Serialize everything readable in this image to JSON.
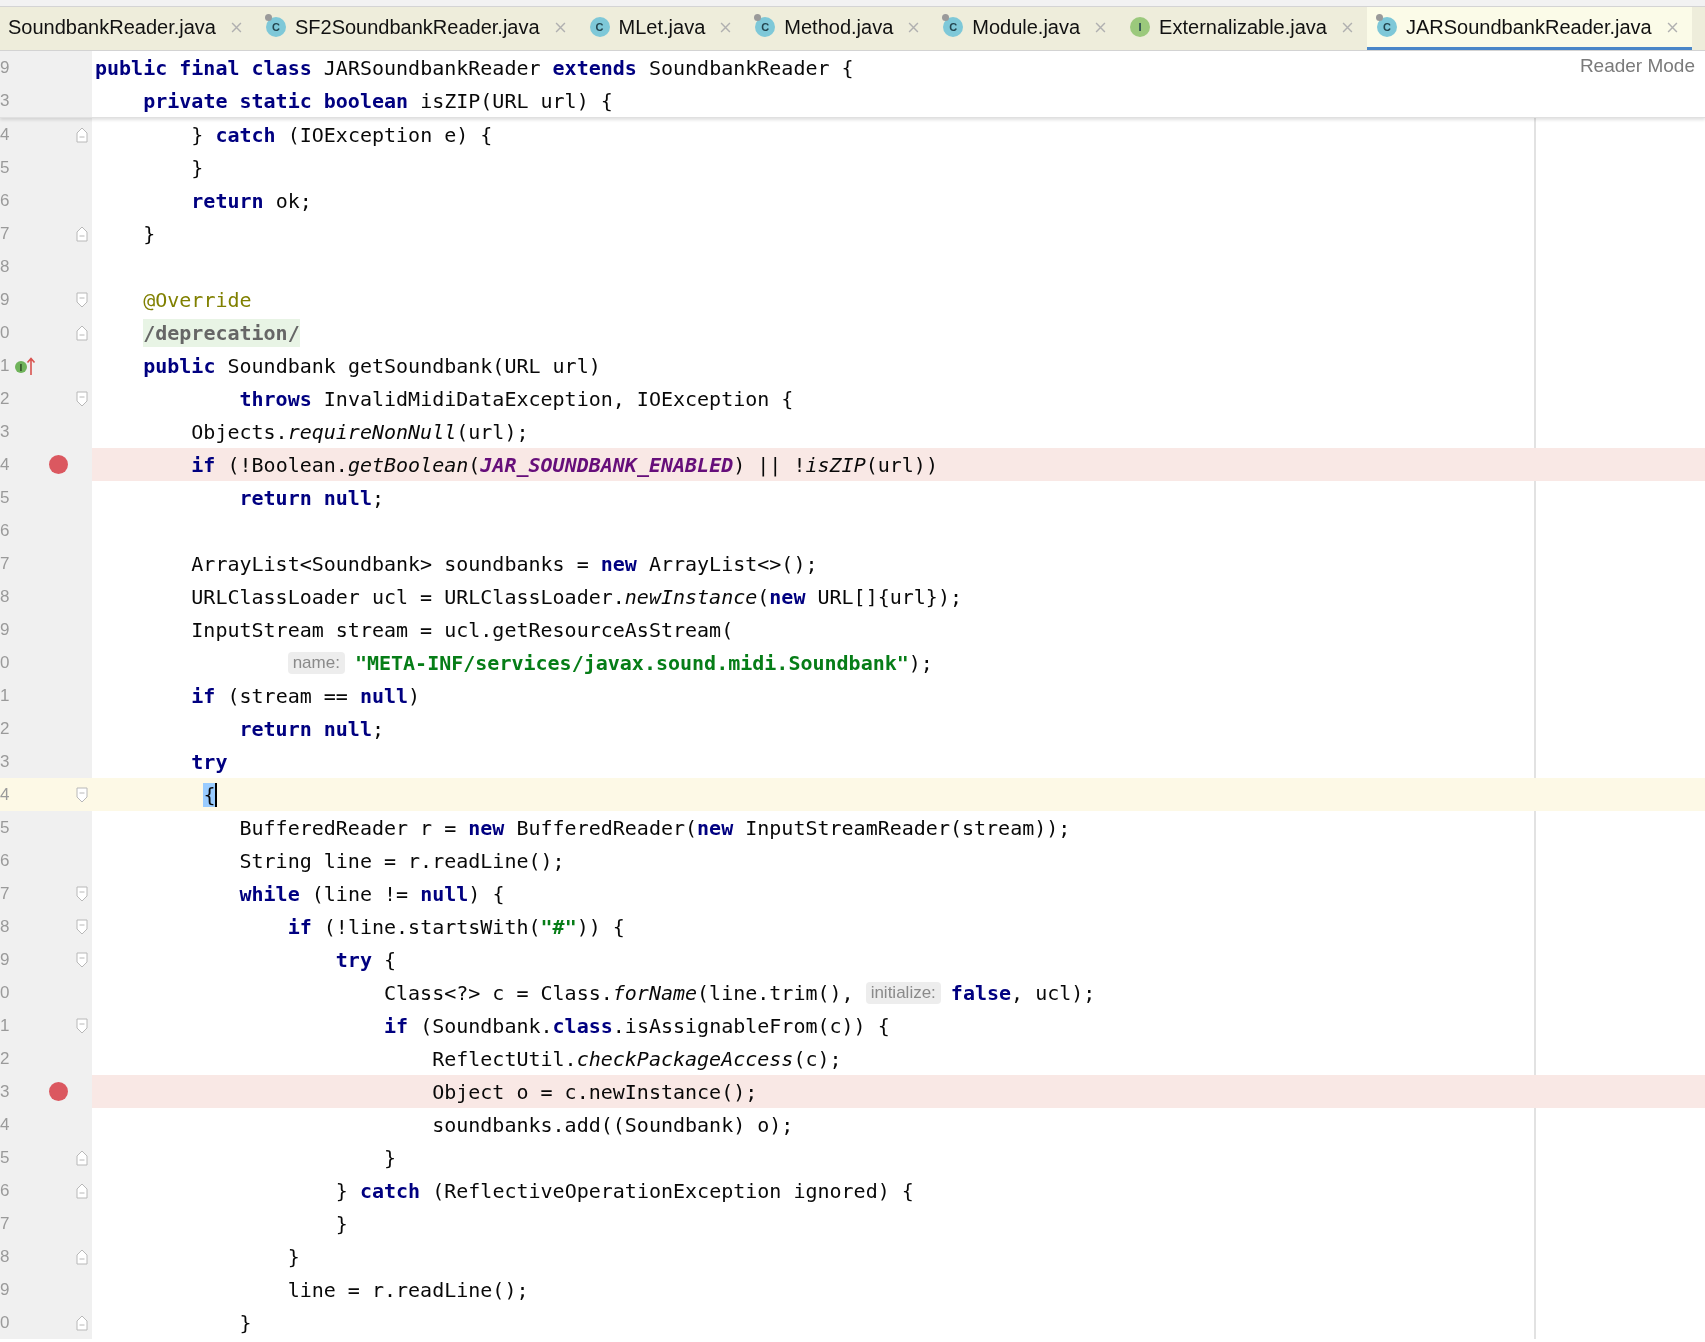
{
  "tabs": [
    {
      "label": "SoundbankReader.java",
      "selected": false
    },
    {
      "label": "SF2SoundbankReader.java",
      "selected": false,
      "icon": {
        "letter": "C",
        "color": "#7ec8d8",
        "locked": true
      }
    },
    {
      "label": "MLet.java",
      "selected": false,
      "icon": {
        "letter": "C",
        "color": "#7ec8d8",
        "locked": false
      }
    },
    {
      "label": "Method.java",
      "selected": false,
      "icon": {
        "letter": "C",
        "color": "#7ec8d8",
        "locked": true
      }
    },
    {
      "label": "Module.java",
      "selected": false,
      "icon": {
        "letter": "C",
        "color": "#7ec8d8",
        "locked": true
      }
    },
    {
      "label": "Externalizable.java",
      "selected": false,
      "icon": {
        "letter": "I",
        "color": "#9bc97c",
        "locked": false
      }
    },
    {
      "label": "JARSoundbankReader.java",
      "selected": true,
      "icon": {
        "letter": "C",
        "color": "#7ec8d8",
        "locked": true
      }
    }
  ],
  "reader_mode": "Reader Mode",
  "sticky_lines": [
    {
      "number": "9",
      "tokens": [
        {
          "t": "public final class",
          "kind": "kw"
        },
        {
          "t": " JARSoundbankReader ",
          "kind": "plain"
        },
        {
          "t": "extends",
          "kind": "kw"
        },
        {
          "t": " SoundbankReader {",
          "kind": "plain"
        }
      ]
    },
    {
      "number": "3",
      "tokens": [
        {
          "t": "    private static boolean",
          "kind": "kw"
        },
        {
          "t": " isZIP(URL url) {",
          "kind": "plain"
        }
      ]
    }
  ],
  "lines": [
    {
      "number": "4",
      "breakpoint": false,
      "current": false,
      "fold": {
        "kind": "end"
      },
      "tokens": [
        {
          "t": "        } ",
          "kind": "plain"
        },
        {
          "t": "catch",
          "kind": "kw"
        },
        {
          "t": " (IOException e) {",
          "kind": "plain"
        }
      ]
    },
    {
      "number": "5",
      "breakpoint": false,
      "current": false,
      "tokens": [
        {
          "t": "        }",
          "kind": "plain"
        }
      ]
    },
    {
      "number": "6",
      "breakpoint": false,
      "current": false,
      "tokens": [
        {
          "t": "        return",
          "kind": "kw"
        },
        {
          "t": " ok;",
          "kind": "plain"
        }
      ]
    },
    {
      "number": "7",
      "breakpoint": false,
      "current": false,
      "fold": {
        "kind": "end"
      },
      "tokens": [
        {
          "t": "    }",
          "kind": "plain"
        }
      ]
    },
    {
      "number": "8",
      "breakpoint": false,
      "current": false
    },
    {
      "number": "9",
      "breakpoint": false,
      "current": false,
      "fold": {
        "kind": "start"
      },
      "tokens": [
        {
          "t": "    @Override",
          "kind": "annotation"
        }
      ]
    },
    {
      "number": "0",
      "breakpoint": false,
      "current": false,
      "fold": {
        "kind": "end"
      },
      "tokens": [
        {
          "t": "    /deprecation/",
          "kind": "folded"
        }
      ]
    },
    {
      "number": "1",
      "breakpoint": false,
      "current": false,
      "marker": {
        "letter": "I",
        "color": "#6fb35a"
      },
      "tokens": [
        {
          "t": "    public",
          "kind": "kw"
        },
        {
          "t": " Soundbank getSoundbank(URL url)",
          "kind": "plain"
        }
      ]
    },
    {
      "number": "2",
      "breakpoint": false,
      "current": false,
      "fold": {
        "kind": "start"
      },
      "tokens": [
        {
          "t": "            throws",
          "kind": "kw"
        },
        {
          "t": " InvalidMidiDataException, IOException {",
          "kind": "plain"
        }
      ]
    },
    {
      "number": "3",
      "breakpoint": false,
      "current": false,
      "tokens": [
        {
          "t": "        Objects.",
          "kind": "plain"
        },
        {
          "t": "requireNonNull",
          "kind": "method"
        },
        {
          "t": "(url);",
          "kind": "plain"
        }
      ]
    },
    {
      "number": "4",
      "breakpoint": true,
      "current": false,
      "tokens": [
        {
          "t": "        if",
          "kind": "kw"
        },
        {
          "t": " (!Boolean.",
          "kind": "plain"
        },
        {
          "t": "getBoolean",
          "kind": "method"
        },
        {
          "t": "(",
          "kind": "plain"
        },
        {
          "t": "JAR_SOUNDBANK_ENABLED",
          "kind": "constant"
        },
        {
          "t": ") || !",
          "kind": "plain"
        },
        {
          "t": "isZIP",
          "kind": "method"
        },
        {
          "t": "(url))",
          "kind": "plain"
        }
      ]
    },
    {
      "number": "5",
      "breakpoint": false,
      "current": false,
      "tokens": [
        {
          "t": "            return null",
          "kind": "kw"
        },
        {
          "t": ";",
          "kind": "plain"
        }
      ]
    },
    {
      "number": "6",
      "breakpoint": false,
      "current": false
    },
    {
      "number": "7",
      "breakpoint": false,
      "current": false,
      "tokens": [
        {
          "t": "        ArrayList<Soundbank> soundbanks = ",
          "kind": "plain"
        },
        {
          "t": "new",
          "kind": "kw"
        },
        {
          "t": " ArrayList<>();",
          "kind": "plain"
        }
      ]
    },
    {
      "number": "8",
      "breakpoint": false,
      "current": false,
      "tokens": [
        {
          "t": "        URLClassLoader ucl = URLClassLoader.",
          "kind": "plain"
        },
        {
          "t": "newInstance",
          "kind": "method"
        },
        {
          "t": "(",
          "kind": "plain"
        },
        {
          "t": "new",
          "kind": "kw"
        },
        {
          "t": " URL[]{url});",
          "kind": "plain"
        }
      ]
    },
    {
      "number": "9",
      "breakpoint": false,
      "current": false,
      "tokens": [
        {
          "t": "        InputStream stream = ucl.getResourceAsStream(",
          "kind": "plain"
        }
      ]
    },
    {
      "number": "0",
      "breakpoint": false,
      "current": false,
      "tokens": [
        {
          "t": "                name:",
          "kind": "hint"
        },
        {
          "t": "\"META-INF/services/javax.sound.midi.Soundbank\"",
          "kind": "string"
        },
        {
          "t": ");",
          "kind": "plain"
        }
      ]
    },
    {
      "number": "1",
      "breakpoint": false,
      "current": false,
      "tokens": [
        {
          "t": "        if",
          "kind": "kw"
        },
        {
          "t": " (stream == ",
          "kind": "plain"
        },
        {
          "t": "null",
          "kind": "kw"
        },
        {
          "t": ")",
          "kind": "plain"
        }
      ]
    },
    {
      "number": "2",
      "breakpoint": false,
      "current": false,
      "tokens": [
        {
          "t": "            return null",
          "kind": "kw"
        },
        {
          "t": ";",
          "kind": "plain"
        }
      ]
    },
    {
      "number": "3",
      "breakpoint": false,
      "current": false,
      "tokens": [
        {
          "t": "        try",
          "kind": "kw"
        }
      ]
    },
    {
      "number": "4",
      "breakpoint": false,
      "current": true,
      "fold": {
        "kind": "start"
      },
      "tokens": [
        {
          "t": "         {",
          "kind": "brace"
        }
      ]
    },
    {
      "number": "5",
      "breakpoint": false,
      "current": false,
      "tokens": [
        {
          "t": "            BufferedReader r = ",
          "kind": "plain"
        },
        {
          "t": "new",
          "kind": "kw"
        },
        {
          "t": " BufferedReader(",
          "kind": "plain"
        },
        {
          "t": "new",
          "kind": "kw"
        },
        {
          "t": " InputStreamReader(stream));",
          "kind": "plain"
        }
      ]
    },
    {
      "number": "6",
      "breakpoint": false,
      "current": false,
      "tokens": [
        {
          "t": "            String line = r.readLine();",
          "kind": "plain"
        }
      ]
    },
    {
      "number": "7",
      "breakpoint": false,
      "current": false,
      "fold": {
        "kind": "start"
      },
      "tokens": [
        {
          "t": "            while",
          "kind": "kw"
        },
        {
          "t": " (line != ",
          "kind": "plain"
        },
        {
          "t": "null",
          "kind": "kw"
        },
        {
          "t": ") {",
          "kind": "plain"
        }
      ]
    },
    {
      "number": "8",
      "breakpoint": false,
      "current": false,
      "fold": {
        "kind": "start"
      },
      "tokens": [
        {
          "t": "                if",
          "kind": "kw"
        },
        {
          "t": " (!line.startsWith(",
          "kind": "plain"
        },
        {
          "t": "\"#\"",
          "kind": "string"
        },
        {
          "t": ")) {",
          "kind": "plain"
        }
      ]
    },
    {
      "number": "9",
      "breakpoint": false,
      "current": false,
      "fold": {
        "kind": "start"
      },
      "tokens": [
        {
          "t": "                    try",
          "kind": "kw"
        },
        {
          "t": " {",
          "kind": "plain"
        }
      ]
    },
    {
      "number": "0",
      "breakpoint": false,
      "current": false,
      "tokens": [
        {
          "t": "                        Class<?> c = Class.",
          "kind": "plain"
        },
        {
          "t": "forName",
          "kind": "method"
        },
        {
          "t": "(line.trim(), ",
          "kind": "plain"
        },
        {
          "t": "initialize:",
          "kind": "hint"
        },
        {
          "t": "false",
          "kind": "kw"
        },
        {
          "t": ", ucl);",
          "kind": "plain"
        }
      ]
    },
    {
      "number": "1",
      "breakpoint": false,
      "current": false,
      "fold": {
        "kind": "start"
      },
      "tokens": [
        {
          "t": "                        if",
          "kind": "kw"
        },
        {
          "t": " (Soundbank.",
          "kind": "plain"
        },
        {
          "t": "class",
          "kind": "kw"
        },
        {
          "t": ".isAssignableFrom(c)) {",
          "kind": "plain"
        }
      ]
    },
    {
      "number": "2",
      "breakpoint": false,
      "current": false,
      "tokens": [
        {
          "t": "                            ReflectUtil.",
          "kind": "plain"
        },
        {
          "t": "checkPackageAccess",
          "kind": "method"
        },
        {
          "t": "(c);",
          "kind": "plain"
        }
      ]
    },
    {
      "number": "3",
      "breakpoint": true,
      "current": false,
      "tokens": [
        {
          "t": "                            Object o = c.newInstance();",
          "kind": "plain"
        }
      ]
    },
    {
      "number": "4",
      "breakpoint": false,
      "current": false,
      "tokens": [
        {
          "t": "                            soundbanks.add((Soundbank) o);",
          "kind": "plain"
        }
      ]
    },
    {
      "number": "5",
      "breakpoint": false,
      "current": false,
      "fold": {
        "kind": "end"
      },
      "tokens": [
        {
          "t": "                        }",
          "kind": "plain"
        }
      ]
    },
    {
      "number": "6",
      "breakpoint": false,
      "current": false,
      "fold": {
        "kind": "end"
      },
      "tokens": [
        {
          "t": "                    } ",
          "kind": "plain"
        },
        {
          "t": "catch",
          "kind": "kw"
        },
        {
          "t": " (ReflectiveOperationException ignored) {",
          "kind": "plain"
        }
      ]
    },
    {
      "number": "7",
      "breakpoint": false,
      "current": false,
      "tokens": [
        {
          "t": "                    }",
          "kind": "plain"
        }
      ]
    },
    {
      "number": "8",
      "breakpoint": false,
      "current": false,
      "fold": {
        "kind": "end"
      },
      "tokens": [
        {
          "t": "                }",
          "kind": "plain"
        }
      ]
    },
    {
      "number": "9",
      "breakpoint": false,
      "current": false,
      "tokens": [
        {
          "t": "                line = r.readLine();",
          "kind": "plain"
        }
      ]
    },
    {
      "number": "0",
      "breakpoint": false,
      "current": false,
      "fold": {
        "kind": "end"
      },
      "tokens": [
        {
          "t": "            }",
          "kind": "plain"
        }
      ]
    }
  ]
}
